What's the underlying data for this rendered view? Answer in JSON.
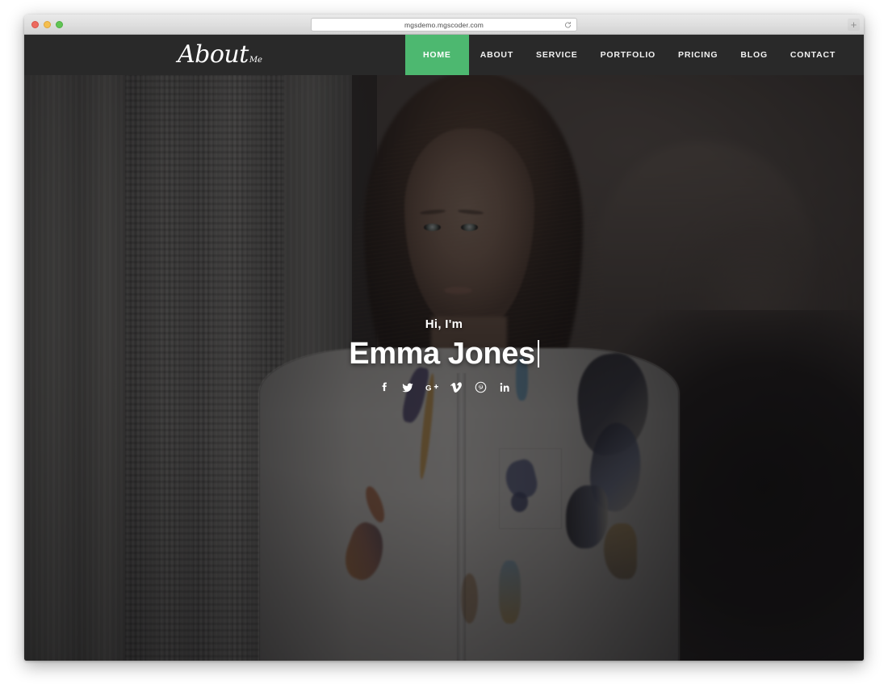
{
  "browser": {
    "url": "mgsdemo.mgscoder.com",
    "reload_icon": "reload-icon",
    "new_tab_label": "+",
    "traffic_lights": [
      {
        "name": "close",
        "color": "#ec6a5f"
      },
      {
        "name": "minimize",
        "color": "#f5bf4f"
      },
      {
        "name": "maximize",
        "color": "#61c554"
      }
    ]
  },
  "site": {
    "logo": {
      "main": "About",
      "sub": "Me"
    },
    "nav": {
      "items": [
        {
          "label": "HOME",
          "active": true
        },
        {
          "label": "ABOUT",
          "active": false
        },
        {
          "label": "SERVICE",
          "active": false
        },
        {
          "label": "PORTFOLIO",
          "active": false
        },
        {
          "label": "PRICING",
          "active": false
        },
        {
          "label": "BLOG",
          "active": false
        },
        {
          "label": "CONTACT",
          "active": false
        }
      ],
      "active_bg": "#4db870",
      "bar_bg": "#292929"
    },
    "hero": {
      "greeting": "Hi, I'm",
      "name": "Emma Jones",
      "typewriter_cursor": true,
      "overlay_color": "rgba(13,13,16,0.62)",
      "social": [
        {
          "name": "facebook-icon",
          "glyph": "f",
          "label": "Facebook"
        },
        {
          "name": "twitter-icon",
          "glyph": "t",
          "label": "Twitter"
        },
        {
          "name": "google-plus-icon",
          "glyph": "G+",
          "label": "Google Plus"
        },
        {
          "name": "vimeo-icon",
          "glyph": "V",
          "label": "Vimeo"
        },
        {
          "name": "pinterest-icon",
          "glyph": "P",
          "label": "Pinterest"
        },
        {
          "name": "linkedin-icon",
          "glyph": "in",
          "label": "LinkedIn"
        }
      ]
    }
  }
}
